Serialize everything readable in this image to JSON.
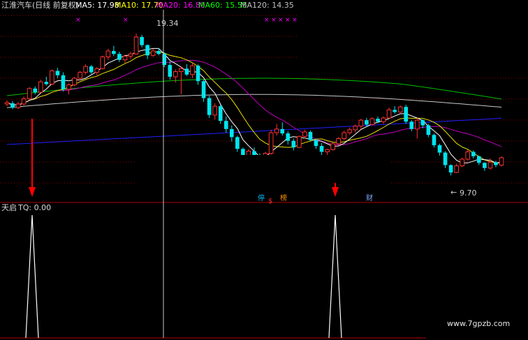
{
  "main_panel": {
    "title": "江淮汽车(日线 前复权)",
    "ma_indicators": [
      {
        "label": "MA5: 17.98",
        "color": "#ffffff"
      },
      {
        "label": "MA10: 17.70",
        "color": "#ffff00"
      },
      {
        "label": "MA20: 16.80",
        "color": "#ff00ff"
      },
      {
        "label": "MA60: 15.55",
        "color": "#00ff00"
      },
      {
        "label": "MA120: 14.35",
        "color": "#c0c0c0"
      }
    ],
    "high_label": "19.34",
    "low_label": "9.70",
    "event_tags": [
      {
        "text": "停",
        "color": "#00bfff"
      },
      {
        "text": "$",
        "color": "#ff3030"
      },
      {
        "text": "榜",
        "color": "#ff8c00"
      },
      {
        "text": "财",
        "color": "#7fa8ff"
      }
    ]
  },
  "sub_panel": {
    "title": "天启",
    "value_label": "TQ: 0.00"
  },
  "watermark": "www.7gpzb.com",
  "colors": {
    "up": "#ff3232",
    "down": "#00e5ee",
    "grid": "#8b0000",
    "signal_arrow": "#ff0000"
  },
  "chart_data": [
    {
      "type": "candlestick",
      "title": "江淮汽车(日线 前复权)",
      "ylim": [
        9.0,
        20.0
      ],
      "annotations": [
        "19.34",
        "9.70"
      ],
      "candles": [
        [
          14.55,
          14.8,
          14.4,
          14.65
        ],
        [
          14.6,
          14.75,
          14.2,
          14.3
        ],
        [
          14.3,
          14.7,
          14.2,
          14.55
        ],
        [
          14.55,
          15.05,
          14.45,
          14.9
        ],
        [
          14.9,
          15.7,
          14.85,
          15.6
        ],
        [
          15.6,
          15.75,
          15.2,
          15.35
        ],
        [
          15.35,
          16.2,
          15.3,
          16.05
        ],
        [
          16.05,
          16.4,
          15.8,
          15.9
        ],
        [
          15.9,
          16.9,
          15.85,
          16.8
        ],
        [
          16.8,
          17.0,
          16.3,
          16.5
        ],
        [
          16.5,
          16.7,
          15.4,
          15.55
        ],
        [
          15.55,
          15.95,
          15.2,
          15.85
        ],
        [
          15.85,
          16.4,
          15.75,
          16.3
        ],
        [
          16.3,
          16.8,
          16.15,
          16.7
        ],
        [
          16.7,
          17.25,
          16.55,
          17.1
        ],
        [
          17.1,
          17.2,
          16.6,
          16.7
        ],
        [
          16.7,
          17.05,
          16.5,
          16.95
        ],
        [
          16.95,
          17.85,
          16.9,
          17.75
        ],
        [
          17.75,
          18.3,
          17.55,
          18.15
        ],
        [
          18.15,
          18.5,
          17.8,
          17.95
        ],
        [
          17.95,
          18.1,
          17.4,
          17.55
        ],
        [
          17.55,
          17.9,
          17.35,
          17.8
        ],
        [
          17.8,
          18.1,
          17.6,
          17.95
        ],
        [
          17.95,
          19.34,
          17.9,
          19.1
        ],
        [
          19.1,
          19.25,
          18.4,
          18.55
        ],
        [
          18.55,
          18.6,
          17.6,
          17.85
        ],
        [
          17.85,
          18.3,
          17.75,
          18.15
        ],
        [
          18.15,
          18.35,
          17.85,
          17.95
        ],
        [
          17.95,
          18.05,
          17.05,
          17.2
        ],
        [
          17.2,
          17.45,
          16.2,
          16.4
        ],
        [
          16.4,
          16.9,
          16.0,
          16.75
        ],
        [
          16.75,
          17.1,
          15.2,
          16.95
        ],
        [
          16.95,
          17.25,
          16.45,
          16.55
        ],
        [
          16.55,
          17.35,
          16.3,
          17.15
        ],
        [
          17.15,
          17.25,
          15.85,
          16.1
        ],
        [
          16.1,
          16.2,
          14.7,
          14.95
        ],
        [
          14.95,
          15.1,
          13.6,
          13.8
        ],
        [
          13.8,
          14.6,
          13.5,
          14.4
        ],
        [
          14.4,
          14.5,
          13.2,
          13.4
        ],
        [
          13.4,
          13.7,
          12.6,
          12.85
        ],
        [
          12.85,
          13.1,
          12.0,
          12.3
        ],
        [
          12.3,
          12.4,
          11.3,
          11.5
        ],
        [
          11.5,
          11.6,
          10.3,
          10.55
        ],
        [
          10.55,
          11.5,
          10.4,
          11.35
        ],
        [
          11.35,
          11.6,
          10.8,
          11.0
        ],
        [
          11.0,
          11.2,
          10.2,
          10.4
        ],
        [
          10.4,
          11.3,
          10.35,
          11.2
        ],
        [
          11.2,
          12.8,
          11.1,
          12.6
        ],
        [
          12.6,
          13.2,
          12.4,
          12.85
        ],
        [
          12.85,
          13.3,
          12.4,
          12.55
        ],
        [
          12.55,
          12.7,
          11.8,
          12.05
        ],
        [
          12.05,
          12.2,
          11.4,
          11.6
        ],
        [
          11.6,
          12.4,
          11.55,
          12.35
        ],
        [
          12.35,
          12.8,
          12.2,
          12.65
        ],
        [
          12.65,
          12.75,
          12.0,
          12.1
        ],
        [
          12.1,
          12.2,
          11.5,
          11.7
        ],
        [
          11.7,
          11.9,
          11.05,
          11.3
        ],
        [
          11.3,
          11.5,
          11.0,
          11.45
        ],
        [
          11.45,
          11.95,
          11.4,
          11.85
        ],
        [
          11.85,
          12.3,
          11.7,
          12.2
        ],
        [
          12.2,
          12.75,
          12.1,
          12.6
        ],
        [
          12.6,
          12.95,
          12.45,
          12.8
        ],
        [
          12.8,
          13.15,
          12.6,
          13.05
        ],
        [
          13.05,
          13.55,
          12.85,
          13.45
        ],
        [
          13.45,
          13.6,
          13.0,
          13.15
        ],
        [
          13.15,
          13.65,
          13.1,
          13.55
        ],
        [
          13.55,
          13.7,
          13.25,
          13.35
        ],
        [
          13.35,
          13.7,
          13.2,
          13.6
        ],
        [
          13.6,
          14.3,
          13.55,
          14.15
        ],
        [
          14.15,
          14.4,
          13.9,
          14.0
        ],
        [
          14.0,
          14.45,
          13.95,
          14.35
        ],
        [
          14.35,
          14.5,
          13.2,
          13.35
        ],
        [
          13.35,
          13.45,
          12.7,
          12.85
        ],
        [
          12.85,
          13.6,
          12.2,
          13.45
        ],
        [
          13.45,
          13.5,
          12.9,
          13.1
        ],
        [
          13.1,
          13.2,
          12.3,
          12.45
        ],
        [
          12.45,
          12.55,
          11.6,
          11.75
        ],
        [
          11.75,
          11.85,
          11.05,
          11.25
        ],
        [
          11.25,
          11.35,
          10.2,
          10.4
        ],
        [
          10.4,
          10.45,
          9.7,
          9.9
        ],
        [
          9.9,
          10.5,
          9.85,
          10.35
        ],
        [
          10.35,
          10.9,
          10.25,
          10.8
        ],
        [
          10.8,
          11.45,
          10.7,
          11.3
        ],
        [
          11.3,
          11.4,
          10.85,
          11.0
        ],
        [
          11.0,
          11.05,
          10.4,
          10.55
        ],
        [
          10.55,
          10.6,
          10.0,
          10.2
        ],
        [
          10.2,
          10.85,
          10.1,
          10.6
        ],
        [
          10.6,
          10.7,
          10.25,
          10.4
        ],
        [
          10.4,
          11.0,
          10.3,
          10.9
        ]
      ]
    },
    {
      "type": "line",
      "title": "天启",
      "series": [
        {
          "name": "TQ",
          "values_note": "spikes to 1 at signal bars, 0 elsewhere",
          "signal_bars": [
            5,
            60
          ]
        }
      ],
      "ylim": [
        0,
        1
      ]
    }
  ]
}
